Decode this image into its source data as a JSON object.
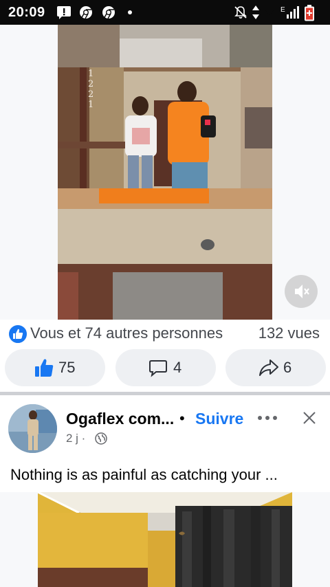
{
  "status_bar": {
    "time": "20:09",
    "network": "E",
    "icons": [
      "alert-icon",
      "chrome-icon",
      "chrome-icon",
      "dot-icon",
      "mute-bell-icon",
      "data-arrows-icon",
      "wifi-icon",
      "signal-icon",
      "battery-low-icon"
    ]
  },
  "video_post": {
    "house_number": "1221",
    "reactions_text": "Vous et 74 autres personnes",
    "views": "132 vues",
    "like_count": "75",
    "comment_count": "4",
    "share_count": "6",
    "colors": {
      "like_blue": "#1877f2",
      "pill_bg": "#eef0f3"
    }
  },
  "next_post": {
    "author": "Ogaflex com...",
    "separator": "•",
    "follow_label": "Suivre",
    "time_ago": "2 j ·",
    "text": "Nothing is as painful as catching your ..."
  }
}
